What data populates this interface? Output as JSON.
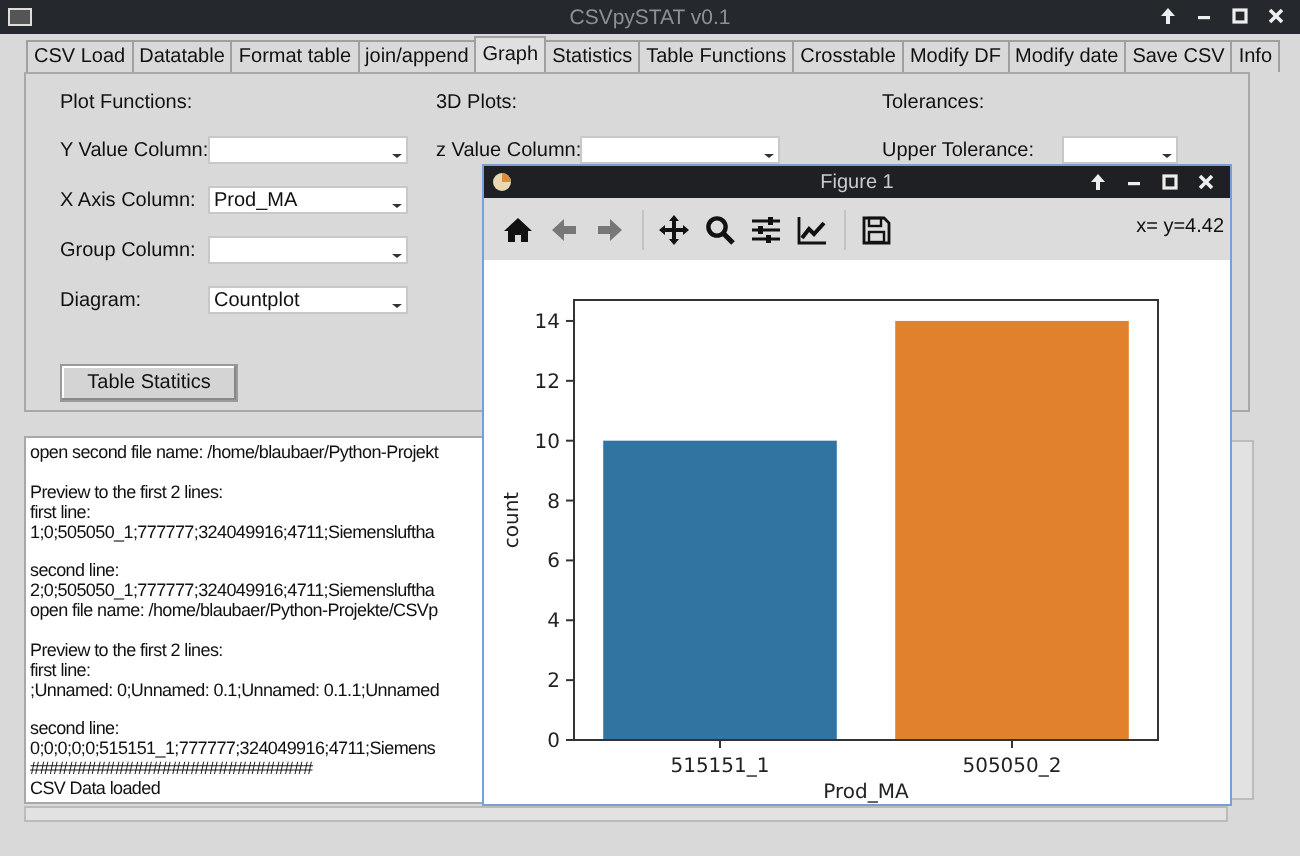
{
  "window": {
    "title": "CSVpySTAT v0.1"
  },
  "tabs": [
    {
      "label": "CSV Load",
      "selected": false
    },
    {
      "label": "Datatable",
      "selected": false
    },
    {
      "label": "Format table",
      "selected": false
    },
    {
      "label": "join/append",
      "selected": false
    },
    {
      "label": "Graph",
      "selected": true
    },
    {
      "label": "Statistics",
      "selected": false
    },
    {
      "label": "Table Functions",
      "selected": false
    },
    {
      "label": "Crosstable",
      "selected": false
    },
    {
      "label": "Modify DF",
      "selected": false
    },
    {
      "label": "Modify date",
      "selected": false
    },
    {
      "label": "Save CSV",
      "selected": false
    },
    {
      "label": "Info",
      "selected": false
    }
  ],
  "plot_functions": {
    "heading": "Plot Functions:",
    "fields": [
      {
        "label": "Y Value Column:"
      },
      {
        "label": "X Axis Column:",
        "value": "Prod_MA"
      },
      {
        "label": "Group Column:"
      },
      {
        "label": "Diagram:",
        "value": "Countplot"
      }
    ],
    "button": "Table Statitics"
  },
  "plots_3d": {
    "heading": "3D Plots:",
    "fields": [
      {
        "label": "z Value Column:"
      }
    ]
  },
  "tolerances": {
    "heading": "Tolerances:",
    "fields": [
      {
        "label": "Upper Tolerance:"
      }
    ]
  },
  "log": {
    "blocks": [
      [
        "open second file name: /home/blaubaer/Python-Projekt"
      ],
      [
        "Preview to the first 2 lines:",
        "first line:",
        "1;0;505050_1;777777;324049916;4711;Siemensluftha"
      ],
      [
        "second line:",
        "2;0;505050_1;777777;324049916;4711;Siemensluftha",
        "open file name: /home/blaubaer/Python-Projekte/CSVp"
      ],
      [
        "Preview to the first 2 lines:",
        "first line:",
        ";Unnamed: 0;Unnamed: 0.1;Unnamed: 0.1.1;Unnamed"
      ],
      [
        "second line:",
        "0;0;0;0;0;515151_1;777777;324049916;4711;Siemens",
        "##############################",
        "CSV Data loaded"
      ]
    ]
  },
  "figure": {
    "title": "Figure 1",
    "coordinates": "x= y=4.42",
    "chart_data": {
      "type": "bar",
      "xlabel": "Prod_MA",
      "ylabel": "count",
      "categories": [
        "515151_1",
        "505050_2"
      ],
      "stacked": true,
      "series": [
        {
          "color": "#3274a1",
          "values": [
            10,
            null
          ]
        },
        {
          "color": "#e1812c",
          "values": [
            null,
            14
          ]
        }
      ],
      "ylim": [
        0,
        14.7
      ],
      "yticks": [
        0,
        2,
        4,
        6,
        8,
        10,
        12,
        14
      ]
    }
  }
}
